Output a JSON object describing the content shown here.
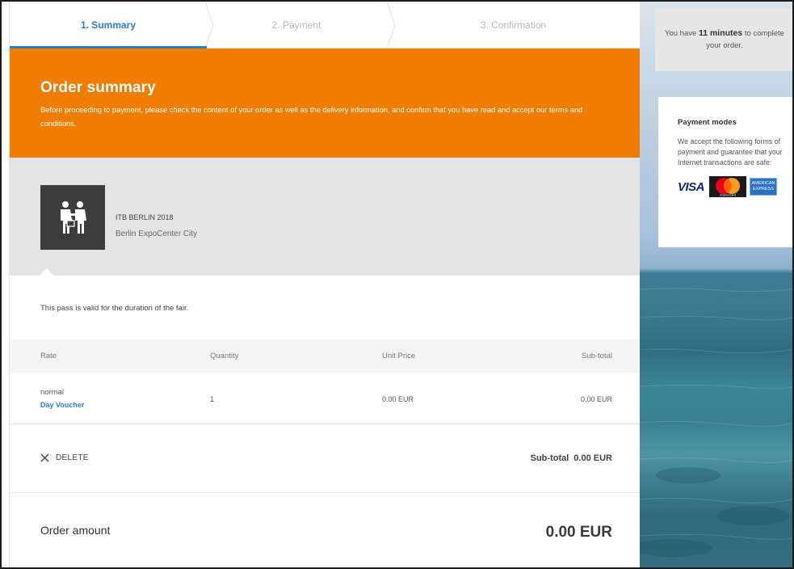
{
  "steps": [
    {
      "label": "1. Summary",
      "active": true
    },
    {
      "label": "2. Payment",
      "active": false
    },
    {
      "label": "3. Confirmation",
      "active": false
    }
  ],
  "banner": {
    "title": "Order summary",
    "text": "Before proceeding to payment, please check the content of your order as well as the delivery information, and confirm that you have read and accept our terms and conditions."
  },
  "event": {
    "name": "ITB BERLIN 2018",
    "venue": "Berlin ExpoCenter City",
    "icon": "handshake-icon"
  },
  "pass_note": "This pass is valid for the duration of the fair.",
  "table": {
    "headers": {
      "rate": "Rate",
      "quantity": "Quantity",
      "unit_price": "Unit Price",
      "subtotal": "Sub-total"
    },
    "rows": [
      {
        "rate": "normal",
        "rate_type": "Day Voucher",
        "quantity": "1",
        "unit_price": "0.00 EUR",
        "subtotal": "0.00 EUR"
      }
    ]
  },
  "actions": {
    "delete_label": "DELETE",
    "subtotal_label": "Sub-total",
    "subtotal_value": "0.00 EUR"
  },
  "order": {
    "label": "Order amount",
    "value": "0.00 EUR"
  },
  "sidebar": {
    "timer_prefix": "You have",
    "timer_value": "11 minutes",
    "timer_suffix": "to complete your order.",
    "payment_title": "Payment modes",
    "payment_text": "We accept the following forms of payment and guarantee that your Internet transactions are safe:",
    "cards": {
      "visa": "VISA",
      "mastercard": "mastercard",
      "amex_line1": "AMERICAN",
      "amex_line2": "EXPRESS"
    }
  },
  "colors": {
    "accent": "#2a7dd1",
    "banner": "#f07d00"
  }
}
